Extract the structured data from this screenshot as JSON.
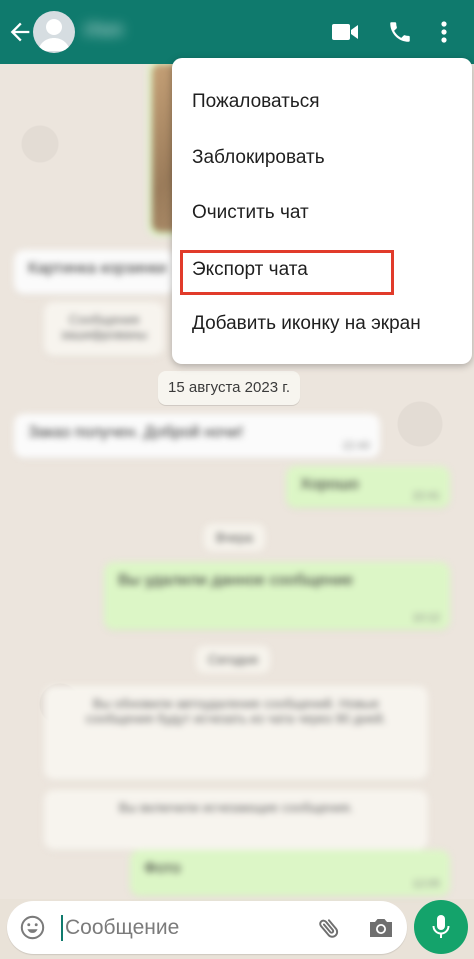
{
  "header": {
    "contact_name": "Имя",
    "icons": [
      "back-arrow-icon",
      "avatar-icon",
      "video-call-icon",
      "phone-icon",
      "more-vertical-icon"
    ]
  },
  "colors": {
    "header_bg": "#0f7a6d",
    "chat_bg": "#ece5dd",
    "outgoing_bubble": "#dcf6c6",
    "highlight": "#e13b2a",
    "mic_button": "#14a36b"
  },
  "menu": {
    "items": [
      {
        "label": "Пожаловаться"
      },
      {
        "label": "Заблокировать"
      },
      {
        "label": "Очистить чат"
      },
      {
        "label": "Экспорт чата",
        "highlighted": true
      },
      {
        "label": "Добавить иконку на экран"
      }
    ]
  },
  "chat": {
    "date_chip": "15 августа 2023 г.",
    "blurred_messages": [
      {
        "text": "Картинка корзинки"
      },
      {
        "text": "Сообщения зашифрованы"
      },
      {
        "text": "Заказ получен. Доброй ночи!",
        "time": "22:40"
      },
      {
        "text": "Хорошо",
        "time": "22:41"
      },
      {
        "text": "Вчера"
      },
      {
        "text": "Вы удалили данное сообщение",
        "time": "10:12"
      },
      {
        "text": "Сегодня"
      },
      {
        "text": "Вы обновили автоудаление сообщений. Новые сообщения будут исчезать из чата через 90 дней."
      },
      {
        "text": "Вы включили исчезающие сообщения."
      },
      {
        "text": "Фото",
        "time": "12:05"
      }
    ]
  },
  "input": {
    "placeholder": "Сообщение",
    "value": ""
  }
}
